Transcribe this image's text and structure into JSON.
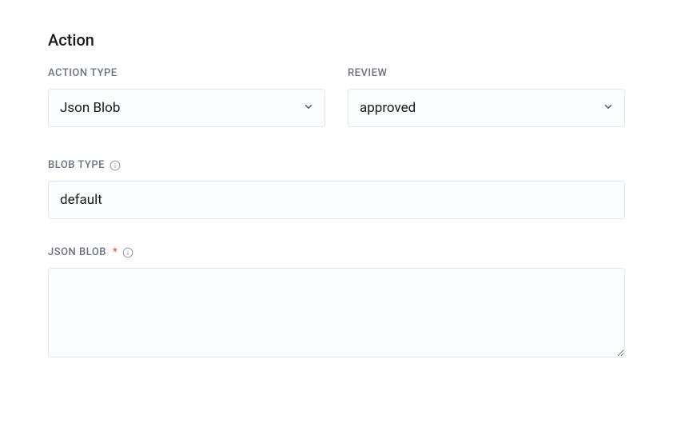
{
  "section": {
    "title": "Action"
  },
  "labels": {
    "action_type": "ACTION TYPE",
    "review": "REVIEW",
    "blob_type": "BLOB TYPE",
    "json_blob": "JSON BLOB"
  },
  "fields": {
    "action_type": {
      "value": "Json Blob"
    },
    "review": {
      "value": "approved"
    },
    "blob_type": {
      "value": "default"
    },
    "json_blob": {
      "value": ""
    }
  }
}
